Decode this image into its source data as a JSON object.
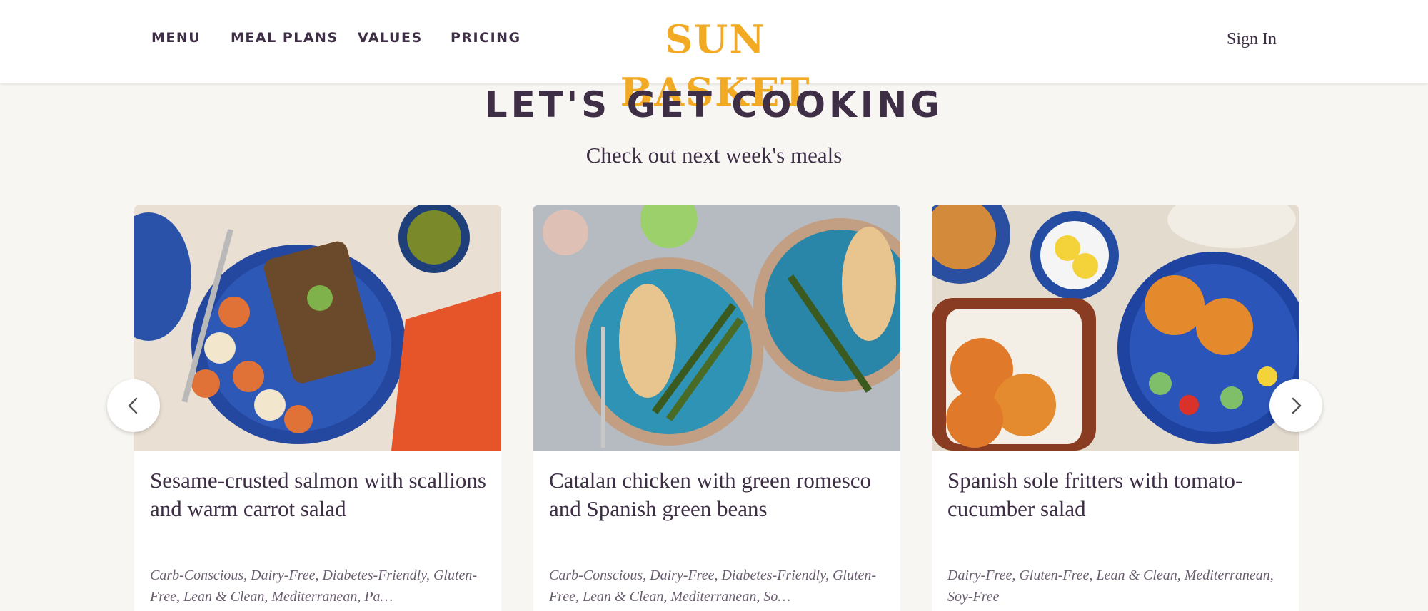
{
  "header": {
    "nav": [
      {
        "label": "MENU"
      },
      {
        "label": "MEAL PLANS"
      },
      {
        "label": "VALUES"
      },
      {
        "label": "PRICING"
      }
    ],
    "logo": "SUN BASKET",
    "sign_in": "Sign In"
  },
  "main": {
    "title": "LET'S GET COOKING",
    "subtitle": "Check out next week's meals",
    "meals": [
      {
        "title": "Sesame-crusted salmon with scallions and warm carrot salad",
        "tags": "Carb-Conscious, Dairy-Free, Diabetes-Friendly, Gluten-Free, Lean & Clean, Mediterranean, Pa…"
      },
      {
        "title": "Catalan chicken with green romesco and Spanish green beans",
        "tags": "Carb-Conscious, Dairy-Free, Diabetes-Friendly, Gluten-Free, Lean & Clean, Mediterranean, So…"
      },
      {
        "title": "Spanish sole fritters with tomato-cucumber salad",
        "tags": "Dairy-Free, Gluten-Free, Lean & Clean, Mediterranean, Soy-Free"
      }
    ]
  },
  "icons": {
    "prev": "chevron-left-icon",
    "next": "chevron-right-icon"
  },
  "colors": {
    "brand_yellow": "#f2aa25",
    "text_purple": "#3f2f46",
    "background": "#f8f6f2"
  }
}
